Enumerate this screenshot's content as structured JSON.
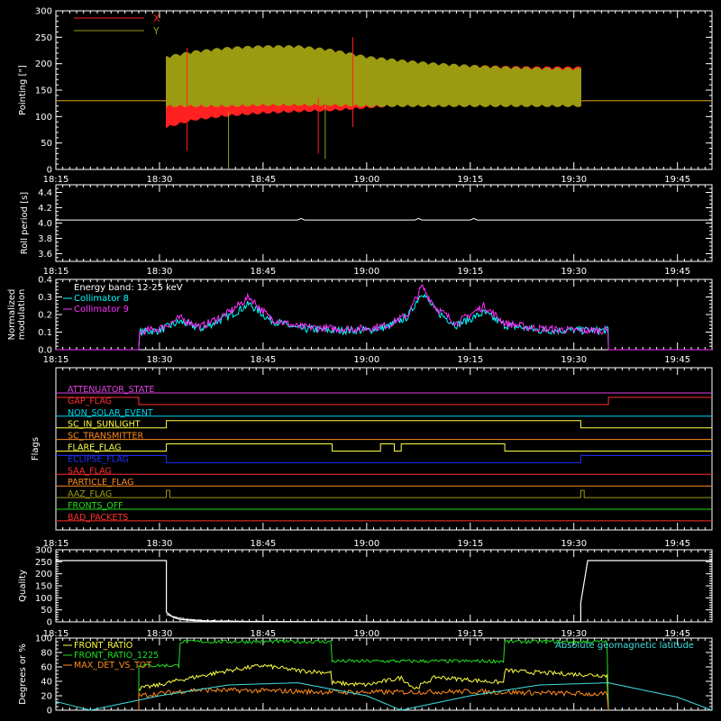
{
  "figure": {
    "background": "#000000",
    "foreground": "#FFFFFF",
    "time_ticks": [
      "18:15",
      "18:30",
      "18:45",
      "19:00",
      "19:15",
      "19:30",
      "19:45"
    ]
  },
  "chart_data": [
    {
      "type": "line",
      "panel": "pointing",
      "ylabel": "Pointing [\"]",
      "ylim": [
        0,
        300
      ],
      "yticks": [
        0,
        50,
        100,
        150,
        200,
        250,
        300
      ],
      "legend": "top-left",
      "series": [
        {
          "name": "X",
          "color": "#FF2020",
          "x": [
            "18:15",
            "18:30",
            "18:31",
            "18:35",
            "18:40",
            "18:45",
            "18:50",
            "18:55",
            "19:00",
            "19:05",
            "19:10",
            "19:15",
            "19:20",
            "19:25",
            "19:31",
            "19:31",
            "19:50"
          ],
          "low": [
            130,
            130,
            78,
            92,
            100,
            105,
            108,
            110,
            115,
            120,
            125,
            128,
            130,
            130,
            130,
            130,
            130
          ],
          "high": [
            130,
            130,
            200,
            215,
            222,
            225,
            225,
            220,
            210,
            205,
            200,
            198,
            196,
            195,
            195,
            130,
            130
          ]
        },
        {
          "name": "Y",
          "color": "#9C9A10",
          "x": [
            "18:15",
            "18:30",
            "18:31",
            "18:35",
            "18:40",
            "18:45",
            "18:50",
            "18:55",
            "19:00",
            "19:05",
            "19:10",
            "19:15",
            "19:20",
            "19:25",
            "19:31",
            "19:31",
            "19:50"
          ],
          "low": [
            130,
            130,
            118,
            118,
            118,
            120,
            120,
            120,
            118,
            118,
            118,
            118,
            118,
            118,
            118,
            130,
            130
          ],
          "high": [
            130,
            130,
            215,
            225,
            232,
            235,
            235,
            228,
            215,
            208,
            202,
            198,
            195,
            193,
            192,
            130,
            130
          ]
        }
      ]
    },
    {
      "type": "line",
      "panel": "roll",
      "ylabel": "Roll period [s]",
      "ylim": [
        3.5,
        4.5
      ],
      "yticks": [
        3.6,
        3.8,
        4.0,
        4.2,
        4.4
      ],
      "series": [
        {
          "name": "",
          "color": "#FFFFFF",
          "x": [
            "18:15",
            "19:50"
          ],
          "y": [
            4.04,
            4.04
          ]
        }
      ]
    },
    {
      "type": "line",
      "panel": "modulation",
      "ylabel": "Normalized modulation",
      "ylim": [
        0,
        0.4
      ],
      "yticks": [
        0.0,
        0.1,
        0.2,
        0.3,
        0.4
      ],
      "annotation": "Energy band: 12-25 keV",
      "legend": "top-left",
      "series": [
        {
          "name": "Collimator 8",
          "color": "#00FFFF",
          "x": [
            "18:15",
            "18:27",
            "18:27",
            "18:30",
            "18:33",
            "18:36",
            "18:40",
            "18:43",
            "18:46",
            "18:50",
            "18:55",
            "19:00",
            "19:03",
            "19:06",
            "19:08",
            "19:10",
            "19:13",
            "19:17",
            "19:20",
            "19:25",
            "19:30",
            "19:34",
            "19:35",
            "19:35",
            "19:50"
          ],
          "y": [
            0,
            0,
            0.1,
            0.11,
            0.16,
            0.12,
            0.19,
            0.26,
            0.17,
            0.12,
            0.11,
            0.11,
            0.13,
            0.19,
            0.33,
            0.22,
            0.14,
            0.21,
            0.14,
            0.11,
            0.11,
            0.11,
            0.11,
            0,
            0
          ]
        },
        {
          "name": "Collimator 9",
          "color": "#FF30FF",
          "x": [
            "18:15",
            "18:27",
            "18:27",
            "18:30",
            "18:33",
            "18:36",
            "18:40",
            "18:43",
            "18:46",
            "18:50",
            "18:55",
            "19:00",
            "19:03",
            "19:06",
            "19:08",
            "19:10",
            "19:13",
            "19:17",
            "19:20",
            "19:25",
            "19:30",
            "19:34",
            "19:35",
            "19:35",
            "19:50"
          ],
          "y": [
            0,
            0,
            0.1,
            0.12,
            0.18,
            0.13,
            0.21,
            0.3,
            0.18,
            0.13,
            0.12,
            0.12,
            0.14,
            0.2,
            0.36,
            0.24,
            0.15,
            0.25,
            0.15,
            0.12,
            0.11,
            0.11,
            0.11,
            0,
            0
          ]
        }
      ]
    },
    {
      "type": "line",
      "panel": "flags",
      "ylabel": "Flags",
      "series": [
        {
          "name": "ATTENUATOR_STATE",
          "color": "#E040E0",
          "x": [
            "18:15",
            "19:50"
          ],
          "y": [
            0,
            0
          ]
        },
        {
          "name": "SAA_FLAG_GAP",
          "label": "GAP_FLAG",
          "color": "#FF3030",
          "x": [
            "18:15",
            "18:27",
            "18:27",
            "19:35",
            "19:35",
            "19:50"
          ],
          "y": [
            1,
            1,
            0,
            0,
            1,
            1
          ]
        },
        {
          "name": "NON_SOLAR_EVENT",
          "color": "#00D8E8",
          "x": [
            "18:15",
            "19:50"
          ],
          "y": [
            0,
            0
          ]
        },
        {
          "name": "SC_IN_SUNLIGHT",
          "color": "#FFFF40",
          "x": [
            "18:15",
            "18:31",
            "18:31",
            "19:31",
            "19:31",
            "19:50"
          ],
          "y": [
            0,
            0,
            1,
            1,
            0,
            0
          ]
        },
        {
          "name": "SC_TRANSMITTER",
          "color": "#FF8C1E",
          "x": [
            "18:15",
            "19:50"
          ],
          "y": [
            0,
            0
          ]
        },
        {
          "name": "FLARE_FLAG",
          "color": "#FFFF40",
          "x": [
            "18:15",
            "18:31",
            "18:31",
            "18:55",
            "18:55",
            "19:02",
            "19:02",
            "19:04",
            "19:04",
            "19:05",
            "19:05",
            "19:20",
            "19:20",
            "19:50"
          ],
          "y": [
            0,
            0,
            1,
            1,
            0,
            0,
            1,
            1,
            0,
            0,
            1,
            1,
            0,
            0
          ]
        },
        {
          "name": "ECLIPSE_FLAG",
          "color": "#1E32FF",
          "x": [
            "18:15",
            "18:31",
            "18:31",
            "19:31",
            "19:31",
            "19:50"
          ],
          "y": [
            1,
            1,
            0,
            0,
            1,
            1
          ]
        },
        {
          "name": "SAA_FLAG",
          "color": "#FF3030",
          "x": [
            "18:15",
            "19:50"
          ],
          "y": [
            0,
            0
          ]
        },
        {
          "name": "PARTICLE_FLAG",
          "color": "#FF8C1E",
          "x": [
            "18:15",
            "19:50"
          ],
          "y": [
            0,
            0
          ]
        },
        {
          "name": "AAZ_FLAG",
          "color": "#9C9A10",
          "x": [
            "18:15",
            "18:31",
            "18:31",
            "18:31.5",
            "18:31.5",
            "19:31",
            "19:31",
            "19:31.5",
            "19:31.5",
            "19:50"
          ],
          "y": [
            0,
            0,
            1,
            1,
            0,
            0,
            1,
            1,
            0,
            0
          ]
        },
        {
          "name": "FRONTS_OFF",
          "color": "#20E020",
          "x": [
            "18:15",
            "19:50"
          ],
          "y": [
            0,
            0
          ]
        },
        {
          "name": "BAD_PACKETS",
          "color": "#FF3030",
          "x": [
            "18:15",
            "19:50"
          ],
          "y": [
            0,
            0
          ]
        }
      ]
    },
    {
      "type": "line",
      "panel": "quality",
      "ylabel": "Quality",
      "ylim": [
        0,
        300
      ],
      "yticks": [
        0,
        50,
        100,
        150,
        200,
        250,
        300
      ],
      "series": [
        {
          "name": "",
          "color": "#FFFFFF",
          "x": [
            "18:15",
            "18:31",
            "18:31",
            "18:31.5",
            "18:32",
            "18:33",
            "18:35",
            "18:40",
            "18:50",
            "19:00",
            "19:30",
            "19:31",
            "19:31",
            "19:32",
            "19:50"
          ],
          "y": [
            255,
            255,
            40,
            30,
            18,
            10,
            5,
            2,
            1,
            0,
            0,
            0,
            80,
            255,
            255
          ]
        }
      ]
    },
    {
      "type": "line",
      "panel": "ratios",
      "ylabel": "Degrees or %",
      "ylim": [
        0,
        100
      ],
      "yticks": [
        0,
        20,
        40,
        60,
        80,
        100
      ],
      "legend": "top-left",
      "annotation": "Absolute geomagnetic latitude",
      "annotation_color": "#40E0E0",
      "series": [
        {
          "name": "FRONT_RATIO",
          "color": "#FFFF40",
          "x": [
            "18:27",
            "18:27",
            "18:30",
            "18:33",
            "18:40",
            "18:45",
            "18:50",
            "18:55",
            "18:55",
            "19:00",
            "19:05",
            "19:07",
            "19:10",
            "19:15",
            "19:20",
            "19:20",
            "19:25",
            "19:30",
            "19:35",
            "19:35"
          ],
          "y": [
            0,
            30,
            35,
            42,
            55,
            62,
            55,
            52,
            38,
            35,
            45,
            30,
            46,
            42,
            38,
            55,
            52,
            50,
            48,
            0
          ]
        },
        {
          "name": "FRONT_RATIO_1225",
          "color": "#20E020",
          "x": [
            "18:27",
            "18:27",
            "18:33",
            "18:33",
            "18:55",
            "18:55",
            "19:20",
            "19:20",
            "19:35",
            "19:35"
          ],
          "y": [
            0,
            62,
            62,
            95,
            95,
            68,
            68,
            95,
            95,
            0
          ]
        },
        {
          "name": "MAX_DET_VS_TOT",
          "color": "#FF8C1E",
          "x": [
            "18:27",
            "18:27",
            "18:35",
            "18:45",
            "18:55",
            "19:05",
            "19:15",
            "19:25",
            "19:35",
            "19:35"
          ],
          "y": [
            0,
            20,
            28,
            27,
            25,
            25,
            26,
            24,
            22,
            0
          ]
        },
        {
          "name": "Absolute geomagnetic latitude",
          "color": "#40E0E0",
          "x": [
            "18:15",
            "18:20",
            "18:30",
            "18:40",
            "18:50",
            "19:00",
            "19:05",
            "19:15",
            "19:25",
            "19:35",
            "19:45",
            "19:50"
          ],
          "y": [
            12,
            0,
            20,
            35,
            38,
            20,
            0,
            20,
            35,
            38,
            18,
            0
          ]
        }
      ]
    }
  ]
}
